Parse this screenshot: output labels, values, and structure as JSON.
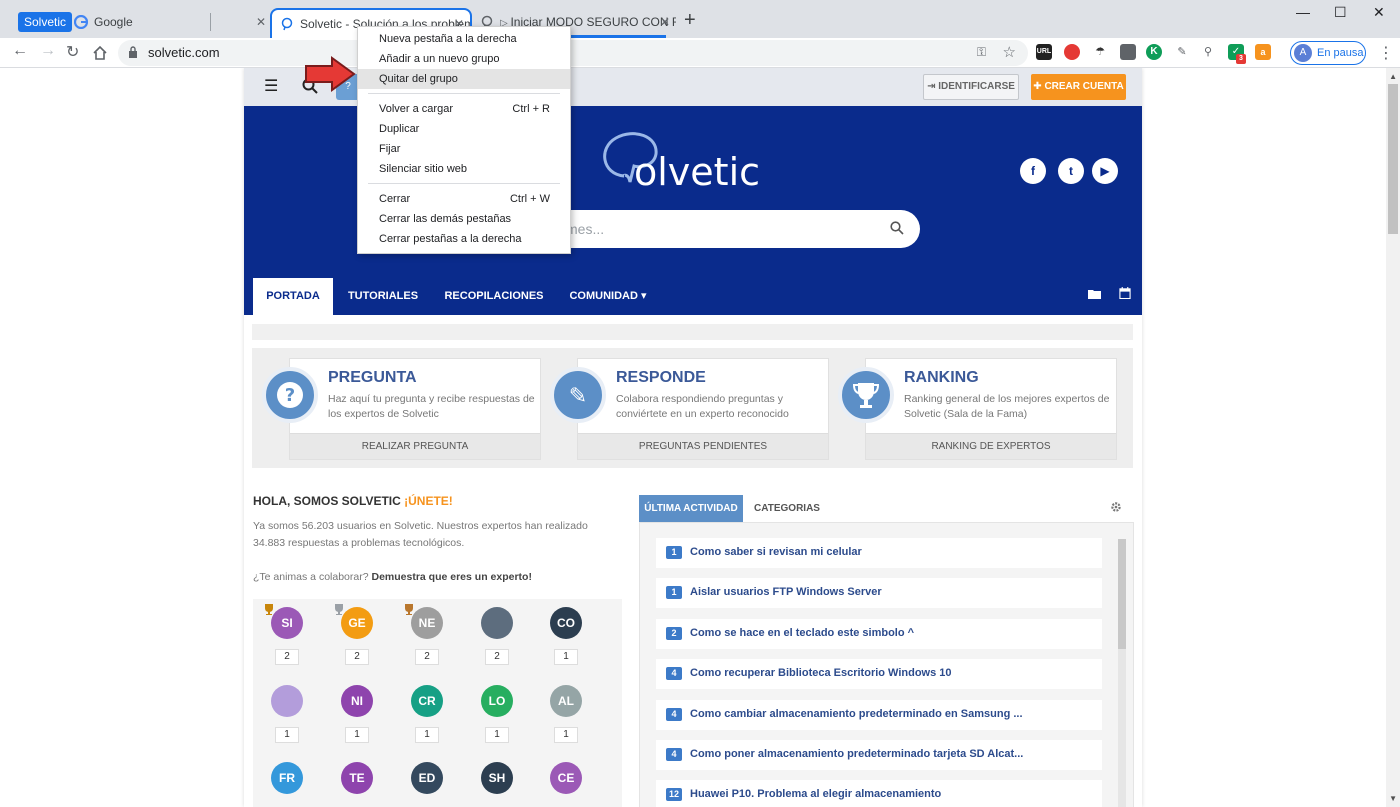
{
  "tabs": {
    "group_label": "Solvetic",
    "tab1": "Google",
    "tab2": "Solvetic - Solución a los problem",
    "tab3": "Iniciar MODO SEGURO CON FL",
    "new_tab": "+",
    "close": "✕"
  },
  "window": {
    "minimize": "—",
    "maximize": "☐",
    "close": "✕"
  },
  "toolbar": {
    "url": "solvetic.com",
    "profile_initial": "A",
    "profile_label": "En pausa",
    "ext_url": "URL",
    "ext_k": "K",
    "ext_badge": "3"
  },
  "context_menu": {
    "items": [
      {
        "label": "Nueva pestaña a la derecha",
        "shortcut": ""
      },
      {
        "label": "Añadir a un nuevo grupo",
        "shortcut": ""
      },
      {
        "label": "Quitar del grupo",
        "shortcut": ""
      },
      {
        "label": "Volver a cargar",
        "shortcut": "Ctrl + R"
      },
      {
        "label": "Duplicar",
        "shortcut": ""
      },
      {
        "label": "Fijar",
        "shortcut": ""
      },
      {
        "label": "Silenciar sitio web",
        "shortcut": ""
      },
      {
        "label": "Cerrar",
        "shortcut": "Ctrl + W"
      },
      {
        "label": "Cerrar las demás pestañas",
        "shortcut": ""
      },
      {
        "label": "Cerrar pestañas a la derecha",
        "shortcut": ""
      }
    ]
  },
  "site": {
    "header": {
      "identify": "⇥ IDENTIFICARSE",
      "create": "✚ CREAR CUENTA"
    },
    "hero": {
      "logo_text": "olvetic",
      "search_placeholder": "mes..."
    },
    "nav": [
      "PORTADA",
      "TUTORIALES",
      "RECOPILACIONES",
      "COMUNIDAD ▾"
    ],
    "cards": [
      {
        "title": "PREGUNTA",
        "desc": "Haz aquí tu pregunta y recibe respuestas de los expertos de Solvetic",
        "foot": "REALIZAR PREGUNTA",
        "icon": "?"
      },
      {
        "title": "RESPONDE",
        "desc": "Colabora respondiendo preguntas y conviértete en un experto reconocido",
        "foot": "PREGUNTAS PENDIENTES",
        "icon": "✎"
      },
      {
        "title": "RANKING",
        "desc": "Ranking general de los mejores expertos de Solvetic (Sala de la Fama)",
        "foot": "RANKING DE EXPERTOS",
        "icon": "🏆"
      }
    ],
    "hola_title": "HOLA, SOMOS SOLVETIC",
    "hola_highlight": "¡ÚNETE!",
    "hola_p1": "Ya somos 56.203 usuarios en Solvetic. Nuestros expertos han realizado 34.883 respuestas a problemas tecnológicos.",
    "hola_p2_a": "¿Te animas a colaborar?",
    "hola_p2_b": "Demuestra que eres un experto!",
    "users": [
      {
        "initials": "SI",
        "count": "2",
        "color": "#9b59b6"
      },
      {
        "initials": "GE",
        "count": "2",
        "color": "#f39c12"
      },
      {
        "initials": "NE",
        "count": "2",
        "color": "#9e9e9e"
      },
      {
        "initials": "",
        "count": "2",
        "color": "#5d6d7e"
      },
      {
        "initials": "CO",
        "count": "1",
        "color": "#2c3e50"
      },
      {
        "initials": "",
        "count": "1",
        "color": "#b39ddb"
      },
      {
        "initials": "NI",
        "count": "1",
        "color": "#8e44ad"
      },
      {
        "initials": "CR",
        "count": "1",
        "color": "#16a085"
      },
      {
        "initials": "LO",
        "count": "1",
        "color": "#27ae60"
      },
      {
        "initials": "AL",
        "count": "1",
        "color": "#95a5a6"
      },
      {
        "initials": "FR",
        "count": "",
        "color": "#3498db"
      },
      {
        "initials": "TE",
        "count": "",
        "color": "#8e44ad"
      },
      {
        "initials": "ED",
        "count": "",
        "color": "#34495e"
      },
      {
        "initials": "SH",
        "count": "",
        "color": "#2c3e50"
      },
      {
        "initials": "CE",
        "count": "",
        "color": "#9b59b6"
      }
    ],
    "activity_tabs": [
      "ÚLTIMA ACTIVIDAD",
      "CATEGORIAS"
    ],
    "activity": [
      {
        "n": "1",
        "text": "Como saber si revisan mi celular"
      },
      {
        "n": "1",
        "text": "Aislar usuarios FTP Windows Server"
      },
      {
        "n": "2",
        "text": "Como se hace en el teclado este simbolo ^"
      },
      {
        "n": "4",
        "text": "Como recuperar Biblioteca Escritorio Windows 10"
      },
      {
        "n": "4",
        "text": "Como cambiar almacenamiento predeterminado en Samsung ..."
      },
      {
        "n": "4",
        "text": "Como poner almacenamiento predeterminado tarjeta SD Alcat..."
      },
      {
        "n": "12",
        "text": "Huawei P10. Problema al elegir almacenamiento"
      }
    ]
  },
  "colors": {
    "accent": "#1a73e8",
    "navy": "#0a2b8c",
    "orange": "#f6931e",
    "card_blue": "#5c8fc7",
    "arrow_red": "#e53935"
  }
}
